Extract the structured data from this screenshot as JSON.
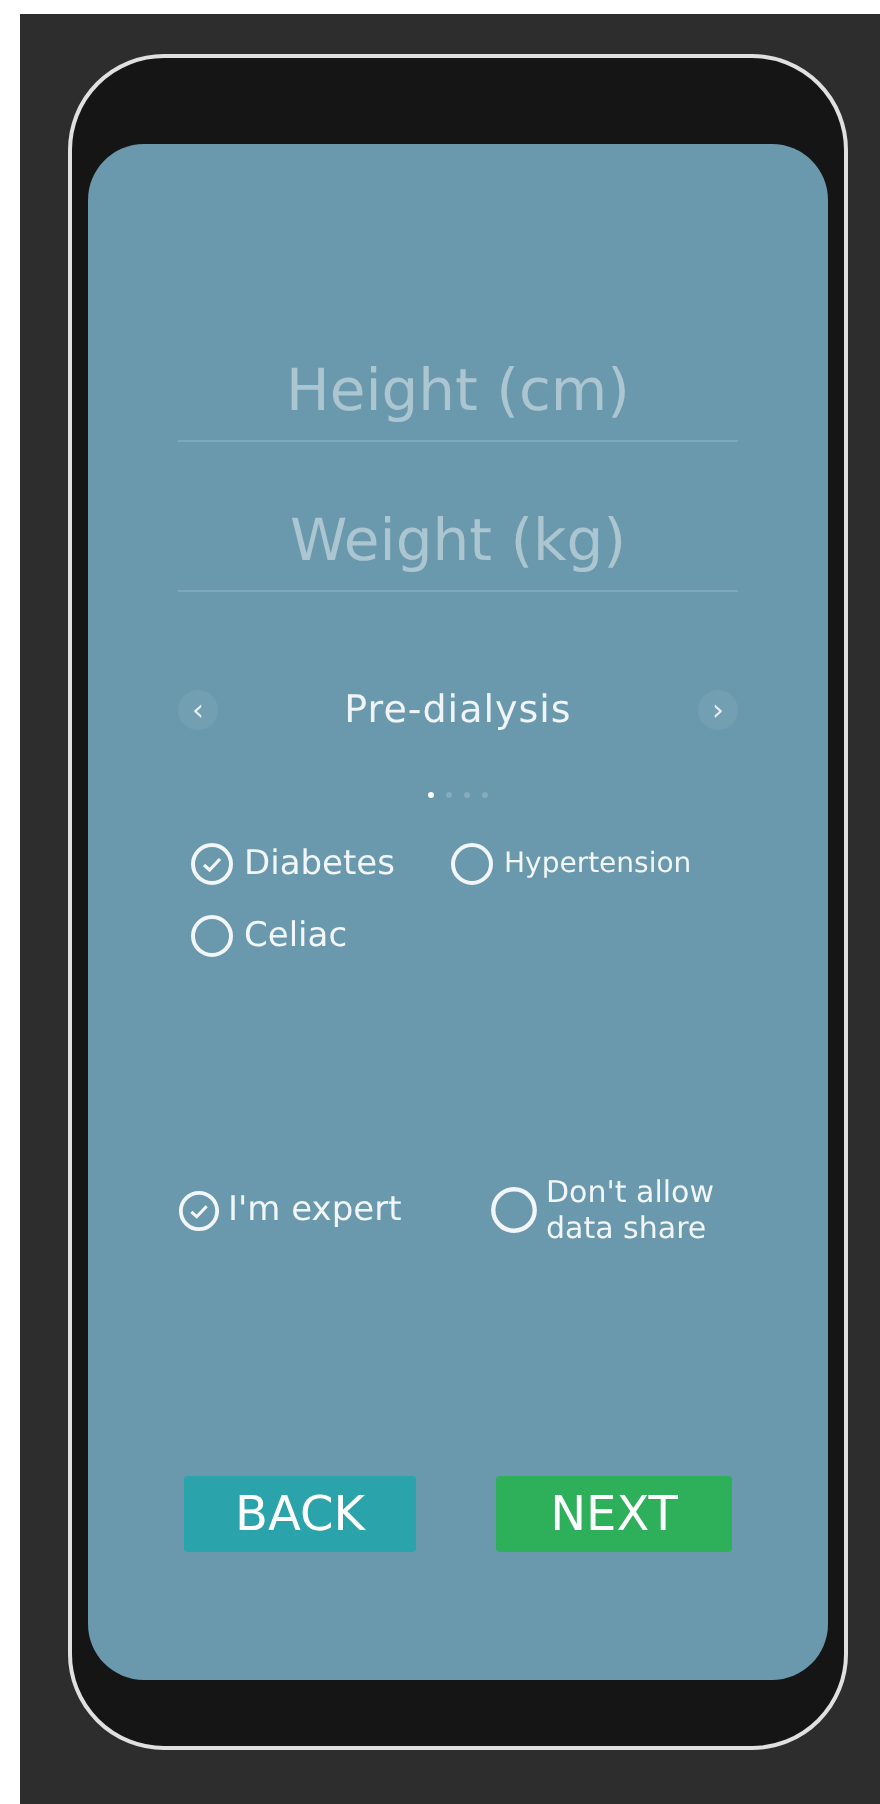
{
  "fields": [
    {
      "placeholder": "Height (cm)"
    },
    {
      "placeholder": "Weight (kg)"
    }
  ],
  "carousel": {
    "prev": "‹",
    "title": "Pre-dialysis",
    "next": "›",
    "pages": [
      {
        "selected": true
      },
      {
        "selected": false
      },
      {
        "selected": false
      },
      {
        "selected": false
      }
    ]
  },
  "conditions": [
    {
      "label": "Diabetes",
      "checked": true
    },
    {
      "label": "Hypertension",
      "checked": false
    },
    {
      "label": "Celiac",
      "checked": false
    }
  ],
  "options": [
    {
      "label": "I'm expert",
      "checked": true
    },
    {
      "label": "Don't allow data share",
      "checked": false
    }
  ],
  "buttons": [
    {
      "label": "BACK",
      "kind": "back"
    },
    {
      "label": "NEXT",
      "kind": "next"
    }
  ]
}
